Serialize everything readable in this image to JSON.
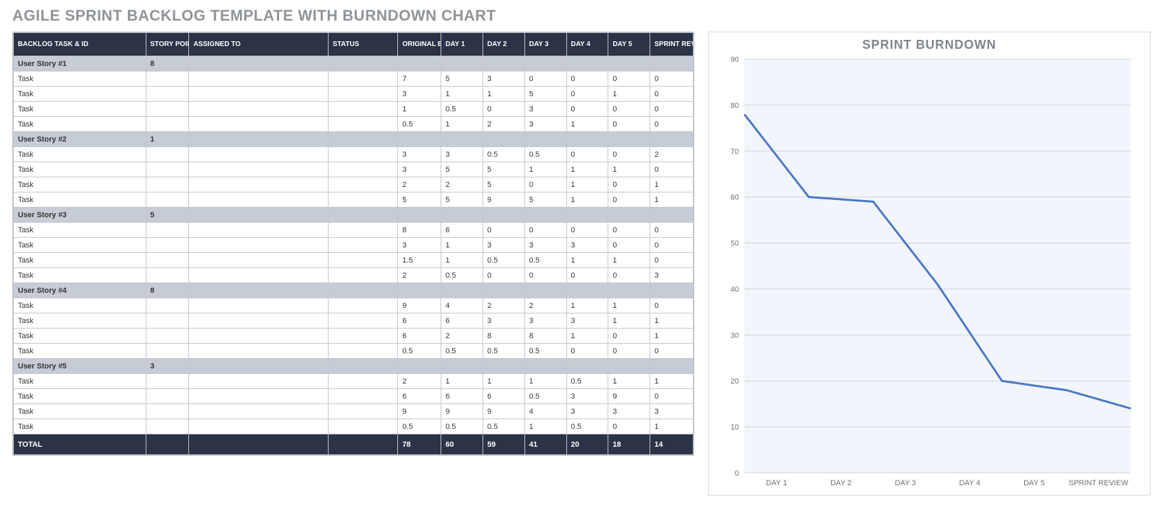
{
  "title": "AGILE SPRINT BACKLOG TEMPLATE WITH BURNDOWN CHART",
  "columns": {
    "name": "BACKLOG TASK & ID",
    "points": "STORY POINTS",
    "assigned": "ASSIGNED TO",
    "status": "STATUS",
    "estimate": "ORIGINAL ESTIMATE",
    "day1": "DAY 1",
    "day2": "DAY 2",
    "day3": "DAY 3",
    "day4": "DAY 4",
    "day5": "DAY 5",
    "review": "SPRINT REVIEW"
  },
  "rows": [
    {
      "type": "story",
      "name": "User Story #1",
      "points": "8"
    },
    {
      "type": "task",
      "name": "Task",
      "est": "7",
      "d1": "5",
      "d2": "3",
      "d3": "0",
      "d4": "0",
      "d5": "0",
      "rev": "0"
    },
    {
      "type": "task",
      "name": "Task",
      "est": "3",
      "d1": "1",
      "d2": "1",
      "d3": "5",
      "d4": "0",
      "d5": "1",
      "rev": "0"
    },
    {
      "type": "task",
      "name": "Task",
      "est": "1",
      "d1": "0.5",
      "d2": "0",
      "d3": "3",
      "d4": "0",
      "d5": "0",
      "rev": "0"
    },
    {
      "type": "task",
      "name": "Task",
      "est": "0.5",
      "d1": "1",
      "d2": "2",
      "d3": "3",
      "d4": "1",
      "d5": "0",
      "rev": "0"
    },
    {
      "type": "story",
      "name": "User Story #2",
      "points": "1"
    },
    {
      "type": "task",
      "name": "Task",
      "est": "3",
      "d1": "3",
      "d2": "0.5",
      "d3": "0.5",
      "d4": "0",
      "d5": "0",
      "rev": "2"
    },
    {
      "type": "task",
      "name": "Task",
      "est": "3",
      "d1": "5",
      "d2": "5",
      "d3": "1",
      "d4": "1",
      "d5": "1",
      "rev": "0"
    },
    {
      "type": "task",
      "name": "Task",
      "est": "2",
      "d1": "2",
      "d2": "5",
      "d3": "0",
      "d4": "1",
      "d5": "0",
      "rev": "1"
    },
    {
      "type": "task",
      "name": "Task",
      "est": "5",
      "d1": "5",
      "d2": "9",
      "d3": "5",
      "d4": "1",
      "d5": "0",
      "rev": "1"
    },
    {
      "type": "story",
      "name": "User Story #3",
      "points": "5"
    },
    {
      "type": "task",
      "name": "Task",
      "est": "8",
      "d1": "6",
      "d2": "0",
      "d3": "0",
      "d4": "0",
      "d5": "0",
      "rev": "0"
    },
    {
      "type": "task",
      "name": "Task",
      "est": "3",
      "d1": "1",
      "d2": "3",
      "d3": "3",
      "d4": "3",
      "d5": "0",
      "rev": "0"
    },
    {
      "type": "task",
      "name": "Task",
      "est": "1.5",
      "d1": "1",
      "d2": "0.5",
      "d3": "0.5",
      "d4": "1",
      "d5": "1",
      "rev": "0"
    },
    {
      "type": "task",
      "name": "Task",
      "est": "2",
      "d1": "0.5",
      "d2": "0",
      "d3": "0",
      "d4": "0",
      "d5": "0",
      "rev": "3"
    },
    {
      "type": "story",
      "name": "User Story #4",
      "points": "8"
    },
    {
      "type": "task",
      "name": "Task",
      "est": "9",
      "d1": "4",
      "d2": "2",
      "d3": "2",
      "d4": "1",
      "d5": "1",
      "rev": "0"
    },
    {
      "type": "task",
      "name": "Task",
      "est": "6",
      "d1": "6",
      "d2": "3",
      "d3": "3",
      "d4": "3",
      "d5": "1",
      "rev": "1"
    },
    {
      "type": "task",
      "name": "Task",
      "est": "6",
      "d1": "2",
      "d2": "8",
      "d3": "8",
      "d4": "1",
      "d5": "0",
      "rev": "1"
    },
    {
      "type": "task",
      "name": "Task",
      "est": "0.5",
      "d1": "0.5",
      "d2": "0.5",
      "d3": "0.5",
      "d4": "0",
      "d5": "0",
      "rev": "0"
    },
    {
      "type": "story",
      "name": "User Story #5",
      "points": "3"
    },
    {
      "type": "task",
      "name": "Task",
      "est": "2",
      "d1": "1",
      "d2": "1",
      "d3": "1",
      "d4": "0.5",
      "d5": "1",
      "rev": "1"
    },
    {
      "type": "task",
      "name": "Task",
      "est": "6",
      "d1": "6",
      "d2": "6",
      "d3": "0.5",
      "d4": "3",
      "d5": "9",
      "rev": "0"
    },
    {
      "type": "task",
      "name": "Task",
      "est": "9",
      "d1": "9",
      "d2": "9",
      "d3": "4",
      "d4": "3",
      "d5": "3",
      "rev": "3"
    },
    {
      "type": "task",
      "name": "Task",
      "est": "0.5",
      "d1": "0.5",
      "d2": "0.5",
      "d3": "1",
      "d4": "0.5",
      "d5": "0",
      "rev": "1"
    }
  ],
  "totals": {
    "label": "TOTAL",
    "est": "78",
    "d1": "60",
    "d2": "59",
    "d3": "41",
    "d4": "20",
    "d5": "18",
    "rev": "14"
  },
  "chart_data": {
    "type": "line",
    "title": "SPRINT BURNDOWN",
    "categories": [
      "DAY 1",
      "DAY 2",
      "DAY 3",
      "DAY 4",
      "DAY 5",
      "SPRINT REVIEW"
    ],
    "x_extra_point": true,
    "values": [
      78,
      60,
      59,
      41,
      20,
      18,
      14
    ],
    "ylim": [
      0,
      90
    ],
    "yticks": [
      0,
      10,
      20,
      30,
      40,
      50,
      60,
      70,
      80,
      90
    ],
    "xlabel": "",
    "ylabel": ""
  }
}
